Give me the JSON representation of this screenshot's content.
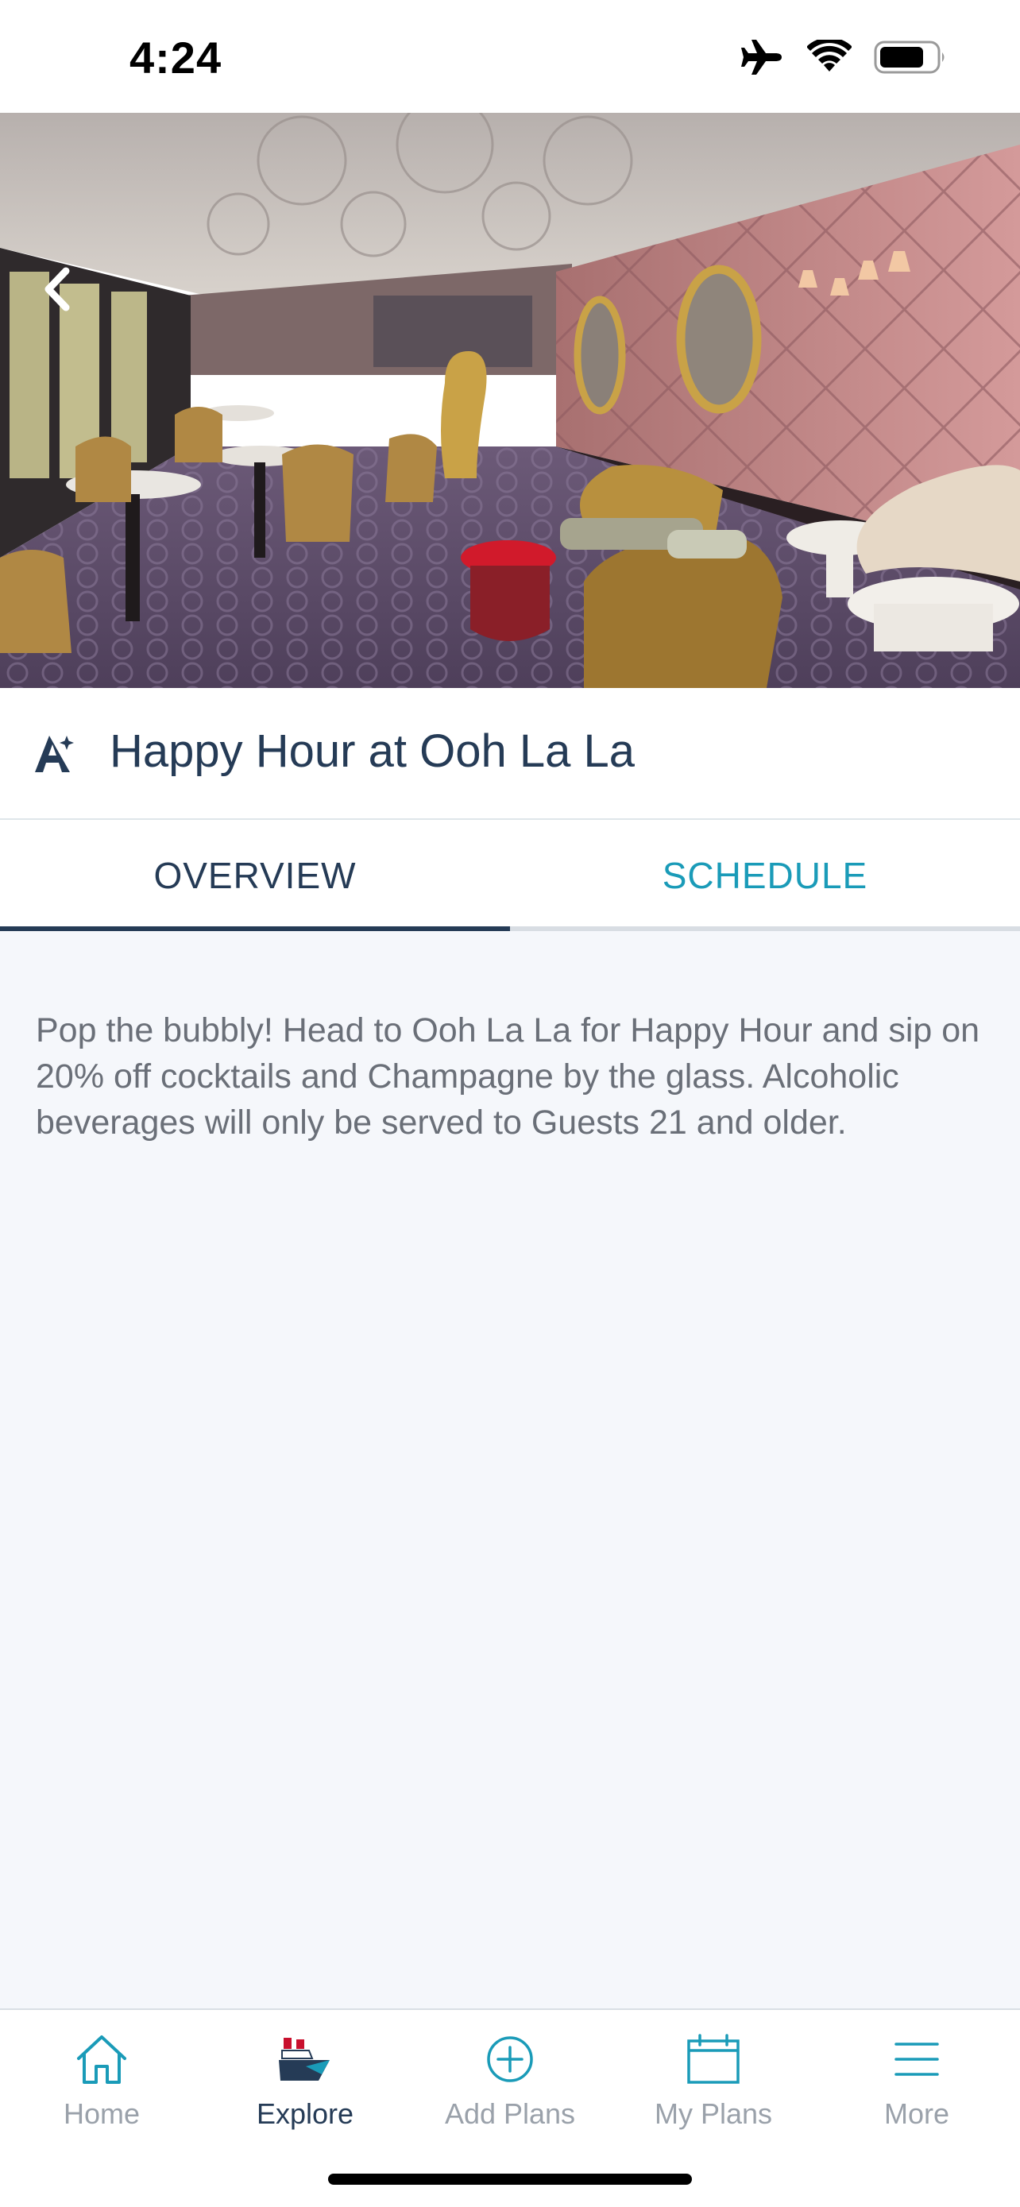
{
  "status_bar": {
    "time": "4:24",
    "icons": [
      "airplane-icon",
      "wifi-icon",
      "battery-icon"
    ]
  },
  "hero": {
    "image_description_icon": "lounge-photo",
    "back_icon": "chevron-left-icon"
  },
  "title": {
    "icon": "magic-sparkle-icon",
    "text": "Happy Hour at Ooh La La"
  },
  "tabs": [
    {
      "label": "OVERVIEW",
      "active": true
    },
    {
      "label": "SCHEDULE",
      "active": false
    }
  ],
  "content": {
    "description": "Pop the bubbly! Head to Ooh La La for Happy Hour and sip on 20% off cocktails and Champagne by the glass. Alcoholic beverages will only be served to Guests 21 and older."
  },
  "bottom_nav": {
    "items": [
      {
        "label": "Home",
        "icon": "home-icon",
        "active": false
      },
      {
        "label": "Explore",
        "icon": "ship-icon",
        "active": true
      },
      {
        "label": "Add Plans",
        "icon": "plus-circle-icon",
        "active": false
      },
      {
        "label": "My Plans",
        "icon": "calendar-icon",
        "active": false
      },
      {
        "label": "More",
        "icon": "hamburger-menu-icon",
        "active": false
      }
    ]
  },
  "colors": {
    "navy": "#253b56",
    "teal": "#1a9bb8",
    "body_text": "#6a6f78",
    "content_bg": "#f5f7fb",
    "inactive_nav": "#9aa1aa"
  }
}
